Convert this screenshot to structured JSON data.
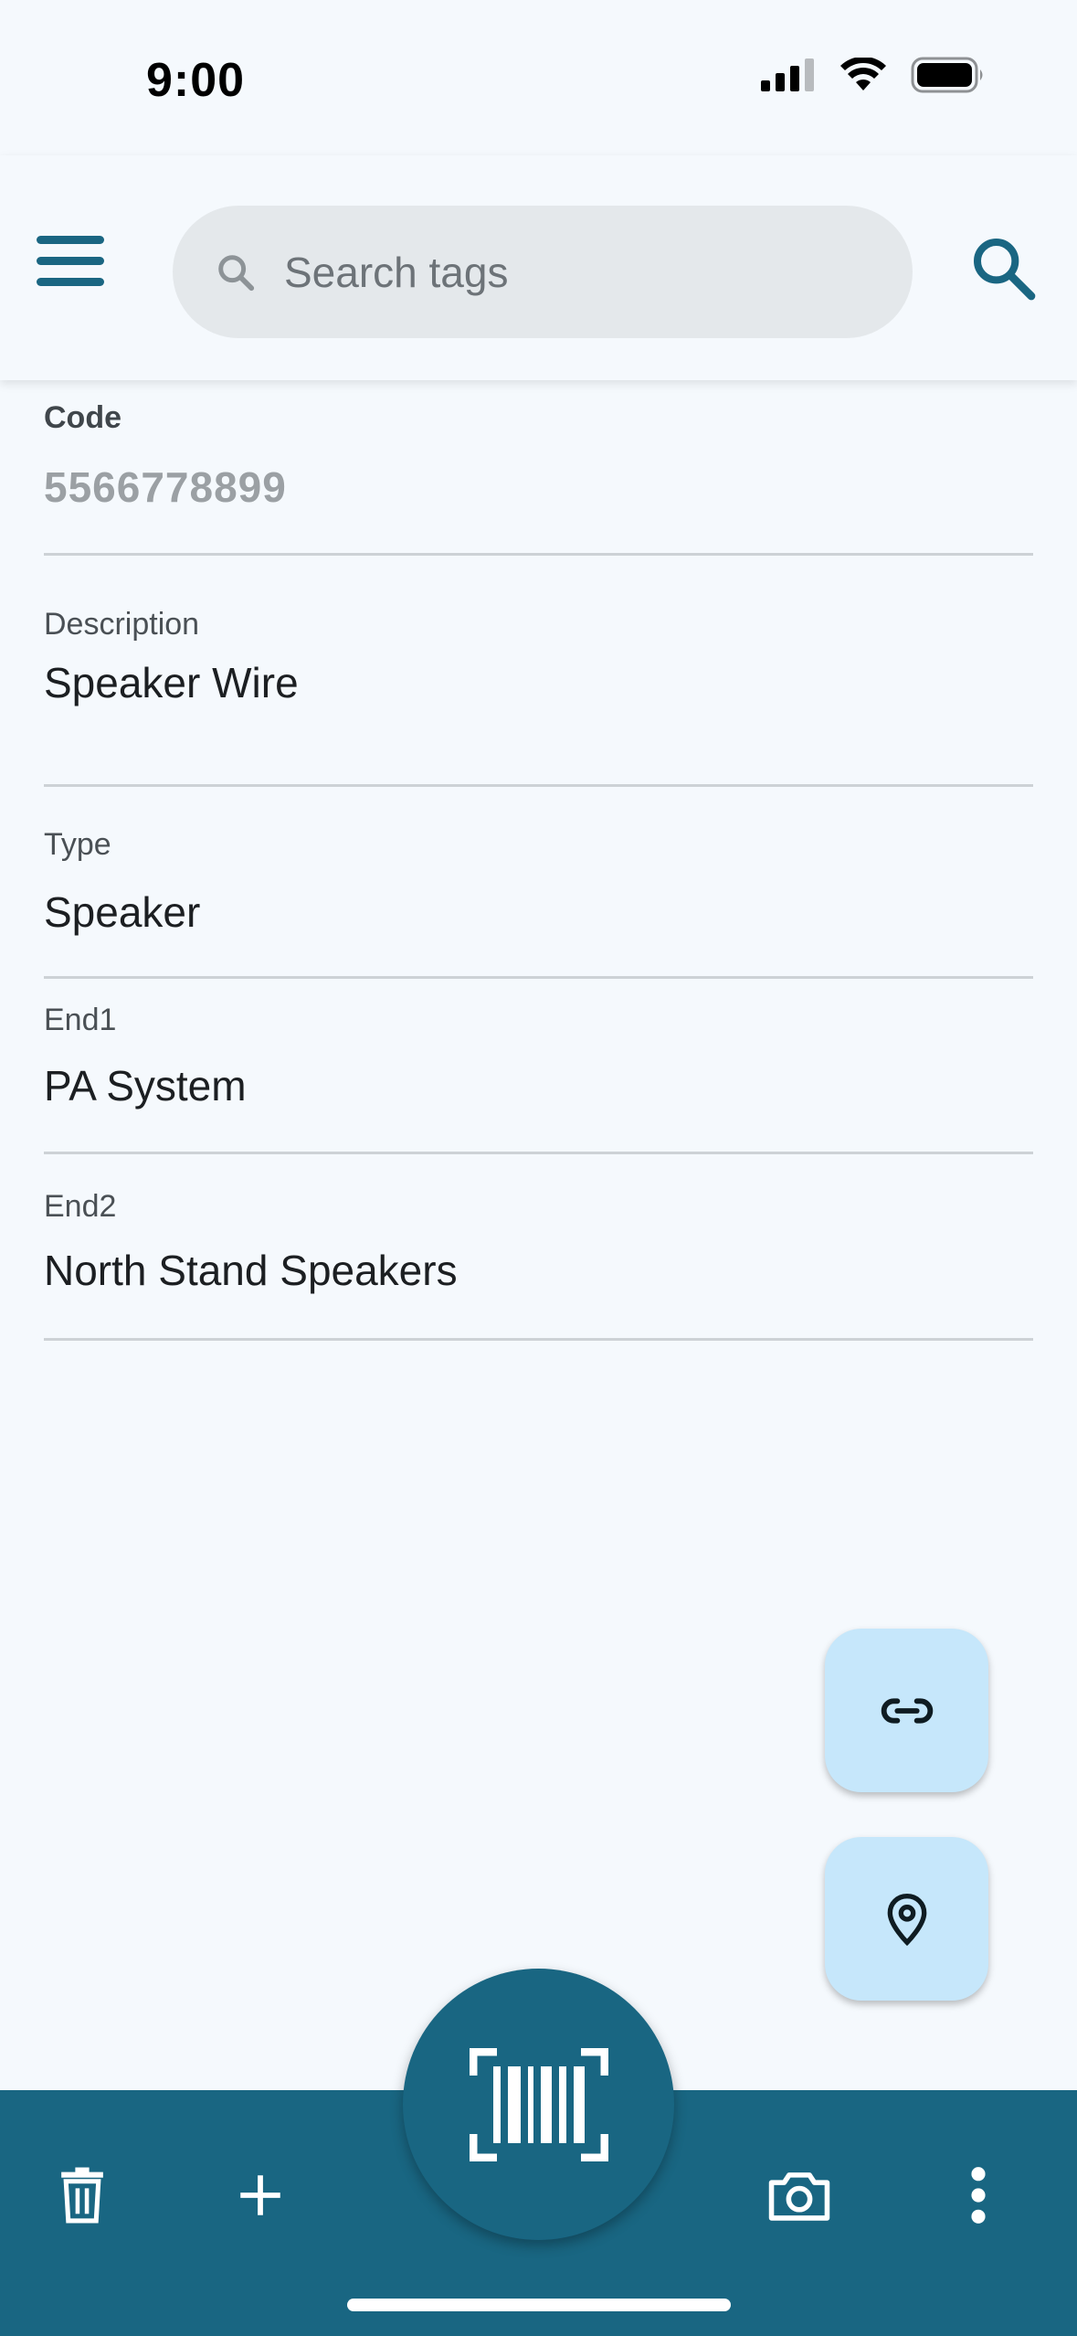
{
  "status_bar": {
    "time": "9:00"
  },
  "search": {
    "placeholder": "Search tags",
    "value": ""
  },
  "fields": {
    "code": {
      "label": "Code",
      "value": "5566778899"
    },
    "description": {
      "label": "Description",
      "value": "Speaker Wire"
    },
    "type": {
      "label": "Type",
      "value": "Speaker"
    },
    "end1": {
      "label": "End1",
      "value": "PA System"
    },
    "end2": {
      "label": "End2",
      "value": "North Stand Speakers"
    }
  },
  "icons": {
    "menu": "menu-icon",
    "search_field": "search-icon",
    "search_action": "search-icon",
    "link": "link-icon",
    "location": "location-pin-icon",
    "delete": "trash-icon",
    "add": "plus-icon",
    "scan": "barcode-scan-icon",
    "camera": "camera-icon",
    "more": "more-vertical-icon"
  },
  "colors": {
    "primary": "#196682",
    "fab_background": "#c6e7fb",
    "background": "#f5f9fd",
    "search_background": "#e4e8eb"
  }
}
